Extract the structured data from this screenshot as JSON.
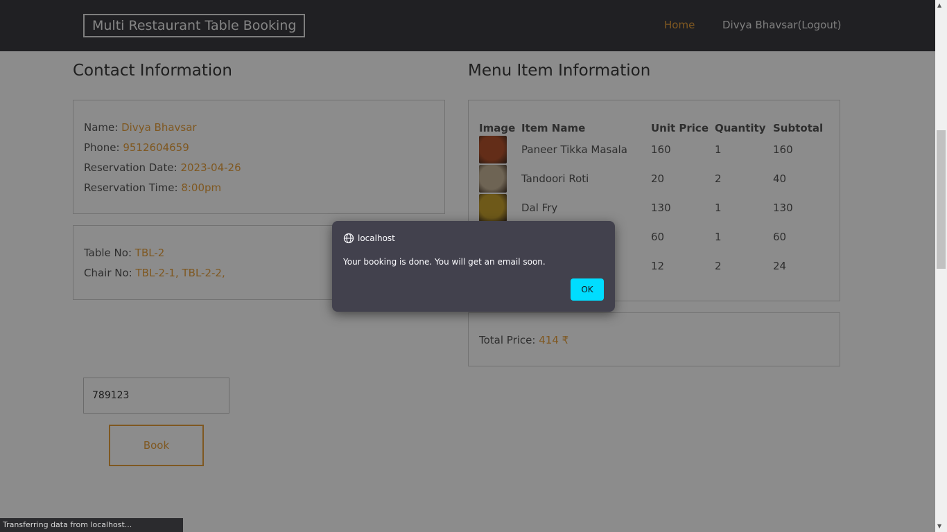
{
  "nav": {
    "brand": "Multi Restaurant Table Booking",
    "links": [
      "Home",
      "Divya Bhavsar(Logout)"
    ]
  },
  "contact": {
    "title": "Contact Information",
    "name_label": "Name:",
    "name": "Divya Bhavsar",
    "phone_label": "Phone:",
    "phone": "9512604659",
    "date_label": "Reservation Date:",
    "date": "2023-04-26",
    "time_label": "Reservation Time:",
    "time": "8:00pm"
  },
  "table_info": {
    "table_label": "Table No:",
    "table": "TBL-2",
    "chair_label": "Chair No:",
    "chairs": "TBL-2-1, TBL-2-2,"
  },
  "menu": {
    "title": "Menu Item Information",
    "headers": [
      "Image",
      "Item Name",
      "Unit Price",
      "Quantity",
      "Subtotal"
    ],
    "rows": [
      {
        "name": "Paneer Tikka Masala",
        "price": "160",
        "qty": "1",
        "subtotal": "160",
        "img_color": "#b5532c"
      },
      {
        "name": "Tandoori Roti",
        "price": "20",
        "qty": "2",
        "subtotal": "40",
        "img_color": "#c9b79a"
      },
      {
        "name": "Dal Fry",
        "price": "130",
        "qty": "1",
        "subtotal": "130",
        "img_color": "#c8a22f"
      },
      {
        "name": "",
        "price": "60",
        "qty": "1",
        "subtotal": "60",
        "img_color": "#a06a3c"
      },
      {
        "name": "",
        "price": "12",
        "qty": "2",
        "subtotal": "24",
        "img_color": "#d9c9a3"
      }
    ]
  },
  "total": {
    "label": "Total Price:",
    "value": "414 ₹"
  },
  "form": {
    "pin_value": "789123",
    "book_label": "Book"
  },
  "dialog": {
    "origin": "localhost",
    "message": "Your booking is done. You will get an email soon.",
    "ok_label": "OK"
  },
  "status_bar": "Transferring data from localhost...",
  "colors": {
    "accent": "#e8a03c",
    "dialog_button": "#00ddff",
    "navbar": "#3b3b40"
  }
}
